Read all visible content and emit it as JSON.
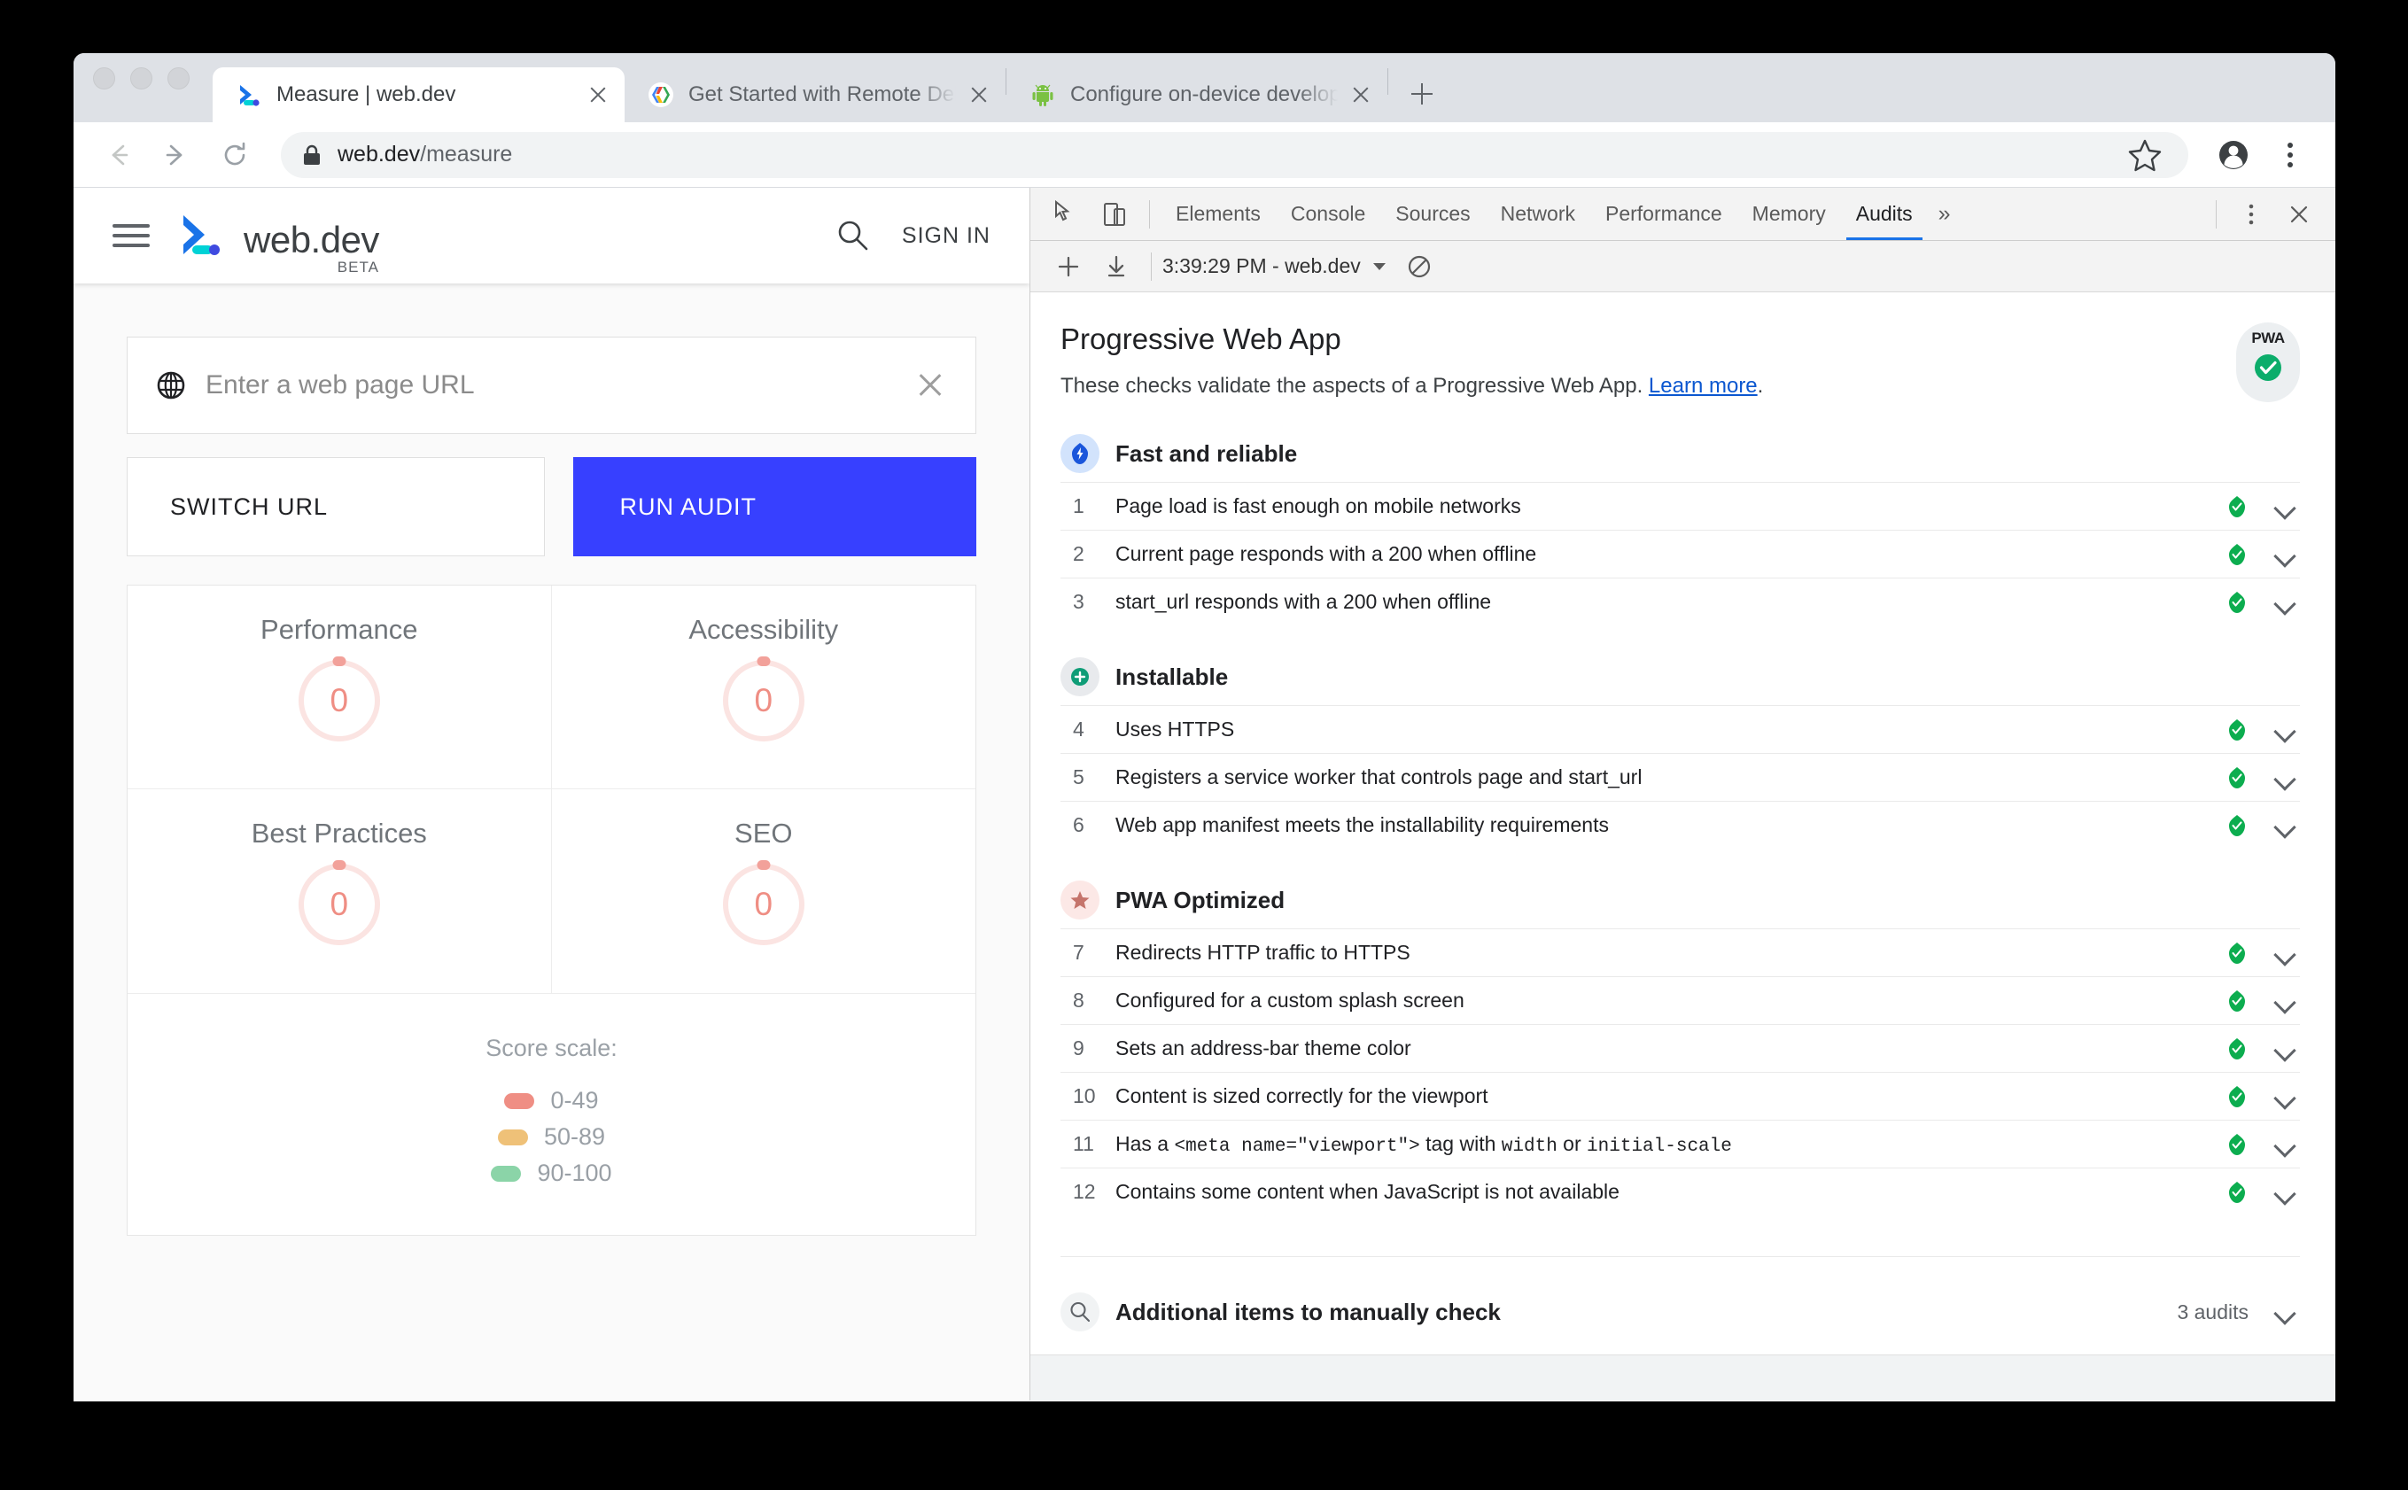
{
  "browser": {
    "tabs": [
      {
        "title": "Measure | web.dev",
        "favicon": "webdev-icon",
        "active": true
      },
      {
        "title": "Get Started with Remote Debug",
        "favicon": "google-developers-icon",
        "active": false
      },
      {
        "title": "Configure on-device developer",
        "favicon": "android-icon",
        "active": false
      }
    ],
    "new_tab_label": "+",
    "omnibox": {
      "host": "web.dev",
      "path": "/measure"
    },
    "nav": {
      "back": "back-arrow",
      "forward": "forward-arrow",
      "reload": "reload-arrow"
    },
    "actions": {
      "bookmark": "star-icon",
      "profile": "profile-avatar-icon",
      "menu": "three-dot-menu-icon"
    }
  },
  "webdev": {
    "brand": {
      "name": "web.dev",
      "beta": "BETA"
    },
    "sign_in": "SIGN IN",
    "url_input": {
      "placeholder": "Enter a web page URL",
      "value": ""
    },
    "switch_url_label": "SWITCH URL",
    "run_audit_label": "RUN AUDIT",
    "run_audit_color": "#3740ff",
    "scores": [
      {
        "label": "Performance",
        "value": "0"
      },
      {
        "label": "Accessibility",
        "value": "0"
      },
      {
        "label": "Best Practices",
        "value": "0"
      },
      {
        "label": "SEO",
        "value": "0"
      }
    ],
    "score_scale": {
      "title": "Score scale:",
      "ranges": [
        {
          "label": "0-49",
          "color": "#ef8e84"
        },
        {
          "label": "50-89",
          "color": "#efc178"
        },
        {
          "label": "90-100",
          "color": "#8bd4a8"
        }
      ]
    }
  },
  "devtools": {
    "tools": {
      "inspect": "inspect-element-icon",
      "device": "device-toolbar-icon"
    },
    "tabs": [
      {
        "label": "Elements",
        "selected": false
      },
      {
        "label": "Console",
        "selected": false
      },
      {
        "label": "Sources",
        "selected": false
      },
      {
        "label": "Network",
        "selected": false
      },
      {
        "label": "Performance",
        "selected": false
      },
      {
        "label": "Memory",
        "selected": false
      },
      {
        "label": "Audits",
        "selected": true
      }
    ],
    "more_tabs": "»",
    "settings_icon": "three-dot-vertical-icon",
    "close_icon": "close-icon",
    "subbar": {
      "add": "+",
      "download": "download-icon",
      "run_label": "3:39:29 PM - web.dev",
      "clear": "clear-icon"
    },
    "report": {
      "title": "Progressive Web App",
      "description_before": "These checks validate the aspects of a Progressive Web App. ",
      "description_link": "Learn more",
      "description_after": ".",
      "badge_text": "PWA",
      "groups": [
        {
          "title": "Fast and reliable",
          "icon": "lightning-bolt-icon",
          "icon_bg": "#d2e3fc",
          "icon_color": "#1a56db",
          "audits": [
            {
              "index": "1",
              "text": "Page load is fast enough on mobile networks",
              "status": "pass"
            },
            {
              "index": "2",
              "text": "Current page responds with a 200 when offline",
              "status": "pass"
            },
            {
              "index": "3",
              "text": "start_url responds with a 200 when offline",
              "status": "pass"
            }
          ]
        },
        {
          "title": "Installable",
          "icon": "plus-circle-icon",
          "icon_bg": "#e8eaed",
          "icon_color": "#0f9d77",
          "audits": [
            {
              "index": "4",
              "text": "Uses HTTPS",
              "status": "pass"
            },
            {
              "index": "5",
              "text": "Registers a service worker that controls page and start_url",
              "status": "pass"
            },
            {
              "index": "6",
              "text": "Web app manifest meets the installability requirements",
              "status": "pass"
            }
          ]
        },
        {
          "title": "PWA Optimized",
          "icon": "star-icon",
          "icon_bg": "#fce8e6",
          "icon_color": "#c5746b",
          "audits": [
            {
              "index": "7",
              "text": "Redirects HTTP traffic to HTTPS",
              "status": "pass"
            },
            {
              "index": "8",
              "text": "Configured for a custom splash screen",
              "status": "pass"
            },
            {
              "index": "9",
              "text": "Sets an address-bar theme color",
              "status": "pass"
            },
            {
              "index": "10",
              "text": "Content is sized correctly for the viewport",
              "status": "pass"
            },
            {
              "index": "11",
              "html": "Has a <code>&lt;meta name=\"viewport\"&gt;</code> tag with <code>width</code> or <code>initial-scale</code>",
              "text": "Has a <meta name=\"viewport\"> tag with width or initial-scale",
              "status": "pass"
            },
            {
              "index": "12",
              "text": "Contains some content when JavaScript is not available",
              "status": "pass"
            }
          ]
        }
      ],
      "manual_section": {
        "title": "Additional items to manually check",
        "icon": "search-icon",
        "count_label": "3 audits"
      }
    }
  }
}
